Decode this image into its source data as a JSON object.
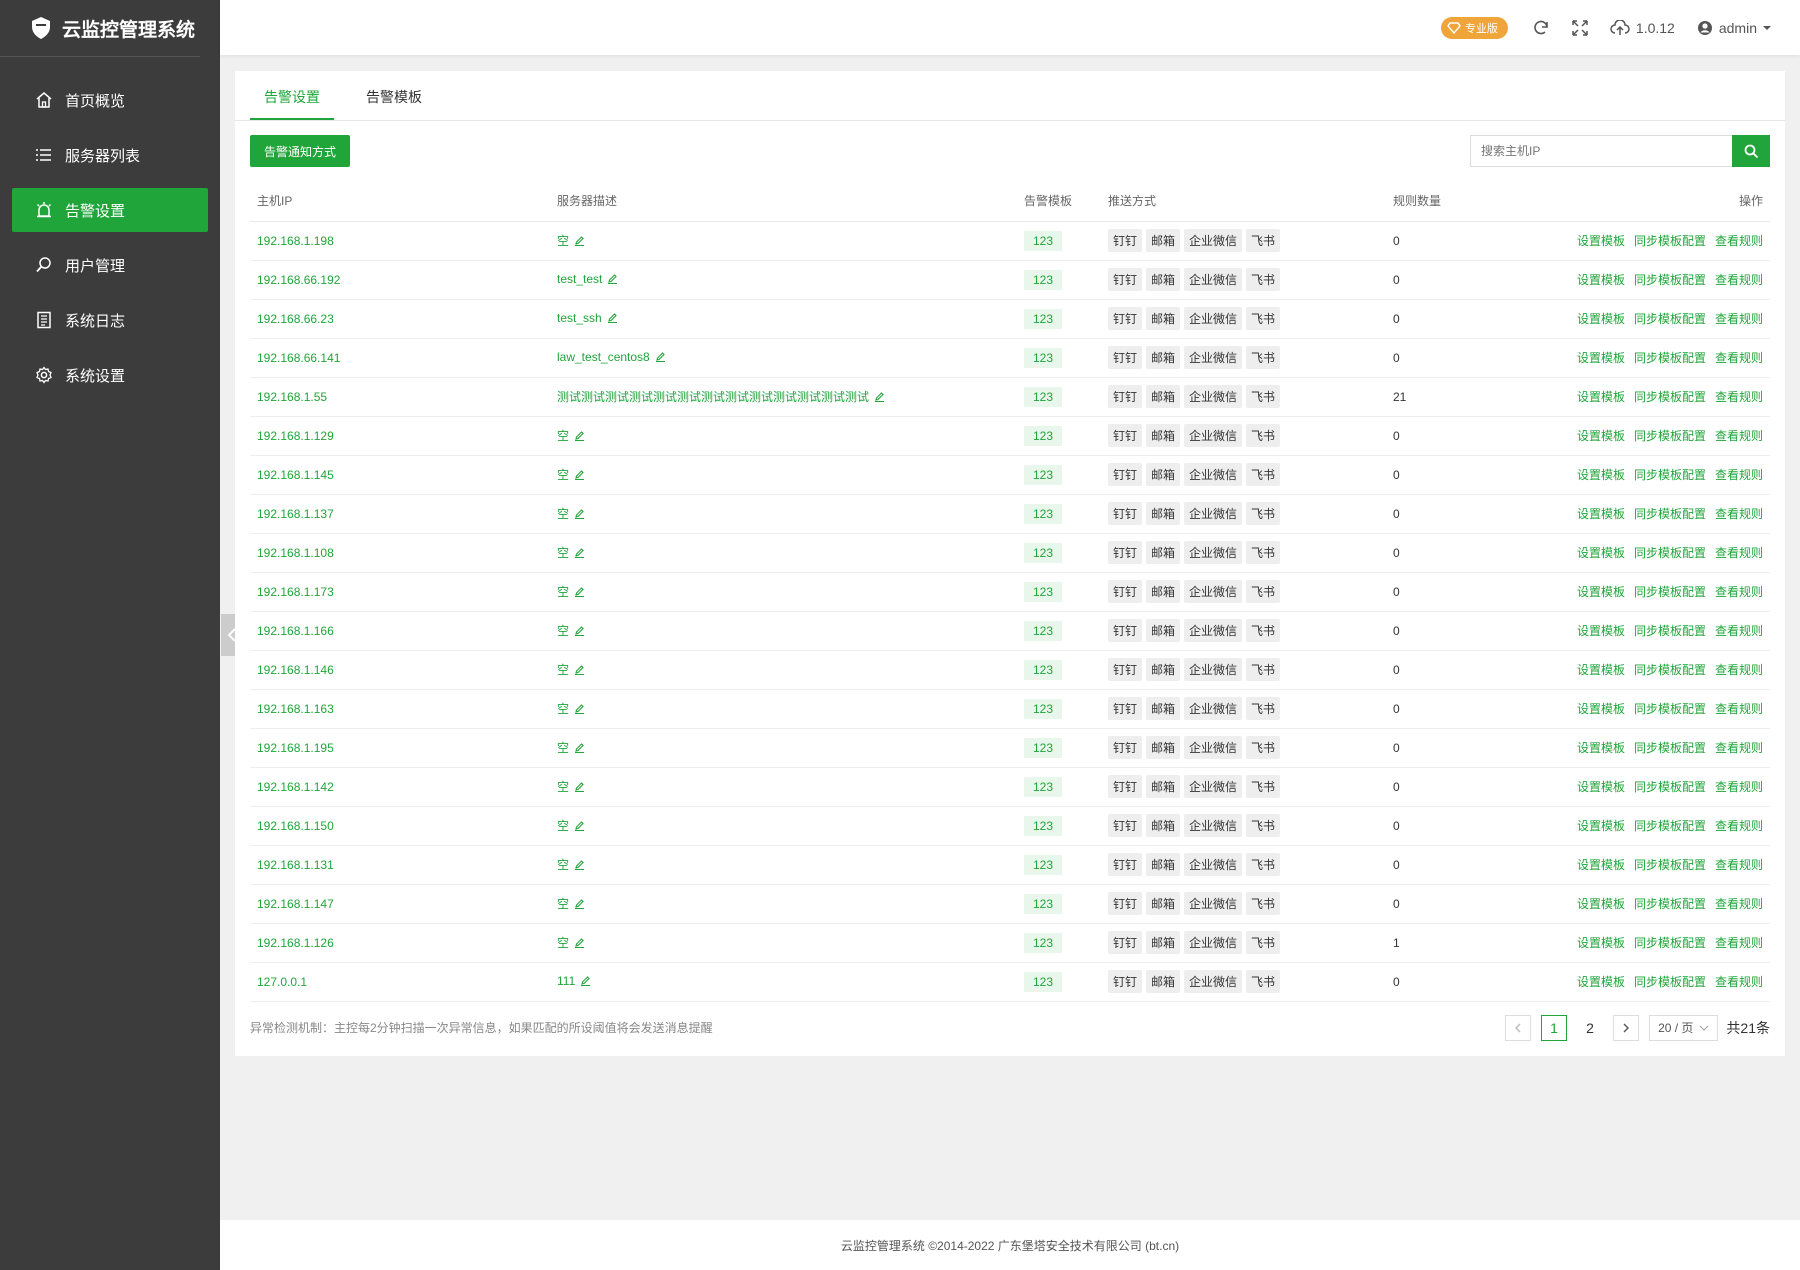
{
  "app": {
    "title": "云监控管理系统"
  },
  "menu": [
    {
      "label": "首页概览",
      "icon": "home-icon"
    },
    {
      "label": "服务器列表",
      "icon": "list-icon"
    },
    {
      "label": "告警设置",
      "icon": "alarm-icon",
      "active": true
    },
    {
      "label": "用户管理",
      "icon": "search-user-icon"
    },
    {
      "label": "系统日志",
      "icon": "log-icon"
    },
    {
      "label": "系统设置",
      "icon": "gear-icon"
    }
  ],
  "topbar": {
    "pro_label": "专业版",
    "version": "1.0.12",
    "user": "admin"
  },
  "tabs": [
    {
      "label": "告警设置",
      "active": true
    },
    {
      "label": "告警模板"
    }
  ],
  "toolbar": {
    "notify_button": "告警通知方式",
    "search_placeholder": "搜索主机IP"
  },
  "table": {
    "headers": [
      "主机IP",
      "服务器描述",
      "告警模板",
      "推送方式",
      "规则数量",
      "操作"
    ],
    "push_tags": [
      "钉钉",
      "邮箱",
      "企业微信",
      "飞书"
    ],
    "op_labels": [
      "设置模板",
      "同步模板配置",
      "查看规则"
    ],
    "rows": [
      {
        "ip": "192.168.1.198",
        "desc": "空",
        "tpl": "123",
        "rules": "0"
      },
      {
        "ip": "192.168.66.192",
        "desc": "test_test",
        "tpl": "123",
        "rules": "0"
      },
      {
        "ip": "192.168.66.23",
        "desc": "test_ssh",
        "tpl": "123",
        "rules": "0"
      },
      {
        "ip": "192.168.66.141",
        "desc": "law_test_centos8",
        "tpl": "123",
        "rules": "0"
      },
      {
        "ip": "192.168.1.55",
        "desc": "测试测试测试测试测试测试测试测试测试测试测试测试测试",
        "tpl": "123",
        "rules": "21"
      },
      {
        "ip": "192.168.1.129",
        "desc": "空",
        "tpl": "123",
        "rules": "0"
      },
      {
        "ip": "192.168.1.145",
        "desc": "空",
        "tpl": "123",
        "rules": "0"
      },
      {
        "ip": "192.168.1.137",
        "desc": "空",
        "tpl": "123",
        "rules": "0"
      },
      {
        "ip": "192.168.1.108",
        "desc": "空",
        "tpl": "123",
        "rules": "0"
      },
      {
        "ip": "192.168.1.173",
        "desc": "空",
        "tpl": "123",
        "rules": "0"
      },
      {
        "ip": "192.168.1.166",
        "desc": "空",
        "tpl": "123",
        "rules": "0"
      },
      {
        "ip": "192.168.1.146",
        "desc": "空",
        "tpl": "123",
        "rules": "0"
      },
      {
        "ip": "192.168.1.163",
        "desc": "空",
        "tpl": "123",
        "rules": "0"
      },
      {
        "ip": "192.168.1.195",
        "desc": "空",
        "tpl": "123",
        "rules": "0"
      },
      {
        "ip": "192.168.1.142",
        "desc": "空",
        "tpl": "123",
        "rules": "0"
      },
      {
        "ip": "192.168.1.150",
        "desc": "空",
        "tpl": "123",
        "rules": "0"
      },
      {
        "ip": "192.168.1.131",
        "desc": "空",
        "tpl": "123",
        "rules": "0"
      },
      {
        "ip": "192.168.1.147",
        "desc": "空",
        "tpl": "123",
        "rules": "0"
      },
      {
        "ip": "192.168.1.126",
        "desc": "空",
        "tpl": "123",
        "rules": "1"
      },
      {
        "ip": "127.0.0.1",
        "desc": "111",
        "tpl": "123",
        "rules": "0"
      }
    ]
  },
  "footer": {
    "note": "异常检测机制：主控每2分钟扫描一次异常信息，如果匹配的所设阈值将会发送消息提醒",
    "pages": [
      "1",
      "2"
    ],
    "page_size": "20 / 页",
    "total": "共21条"
  },
  "copyright": "云监控管理系统 ©2014-2022 广东堡塔安全技术有限公司 (bt.cn)",
  "colors": {
    "accent": "#20a53a",
    "sidebar": "#3c3c3c",
    "pro": "#f0a53a"
  }
}
